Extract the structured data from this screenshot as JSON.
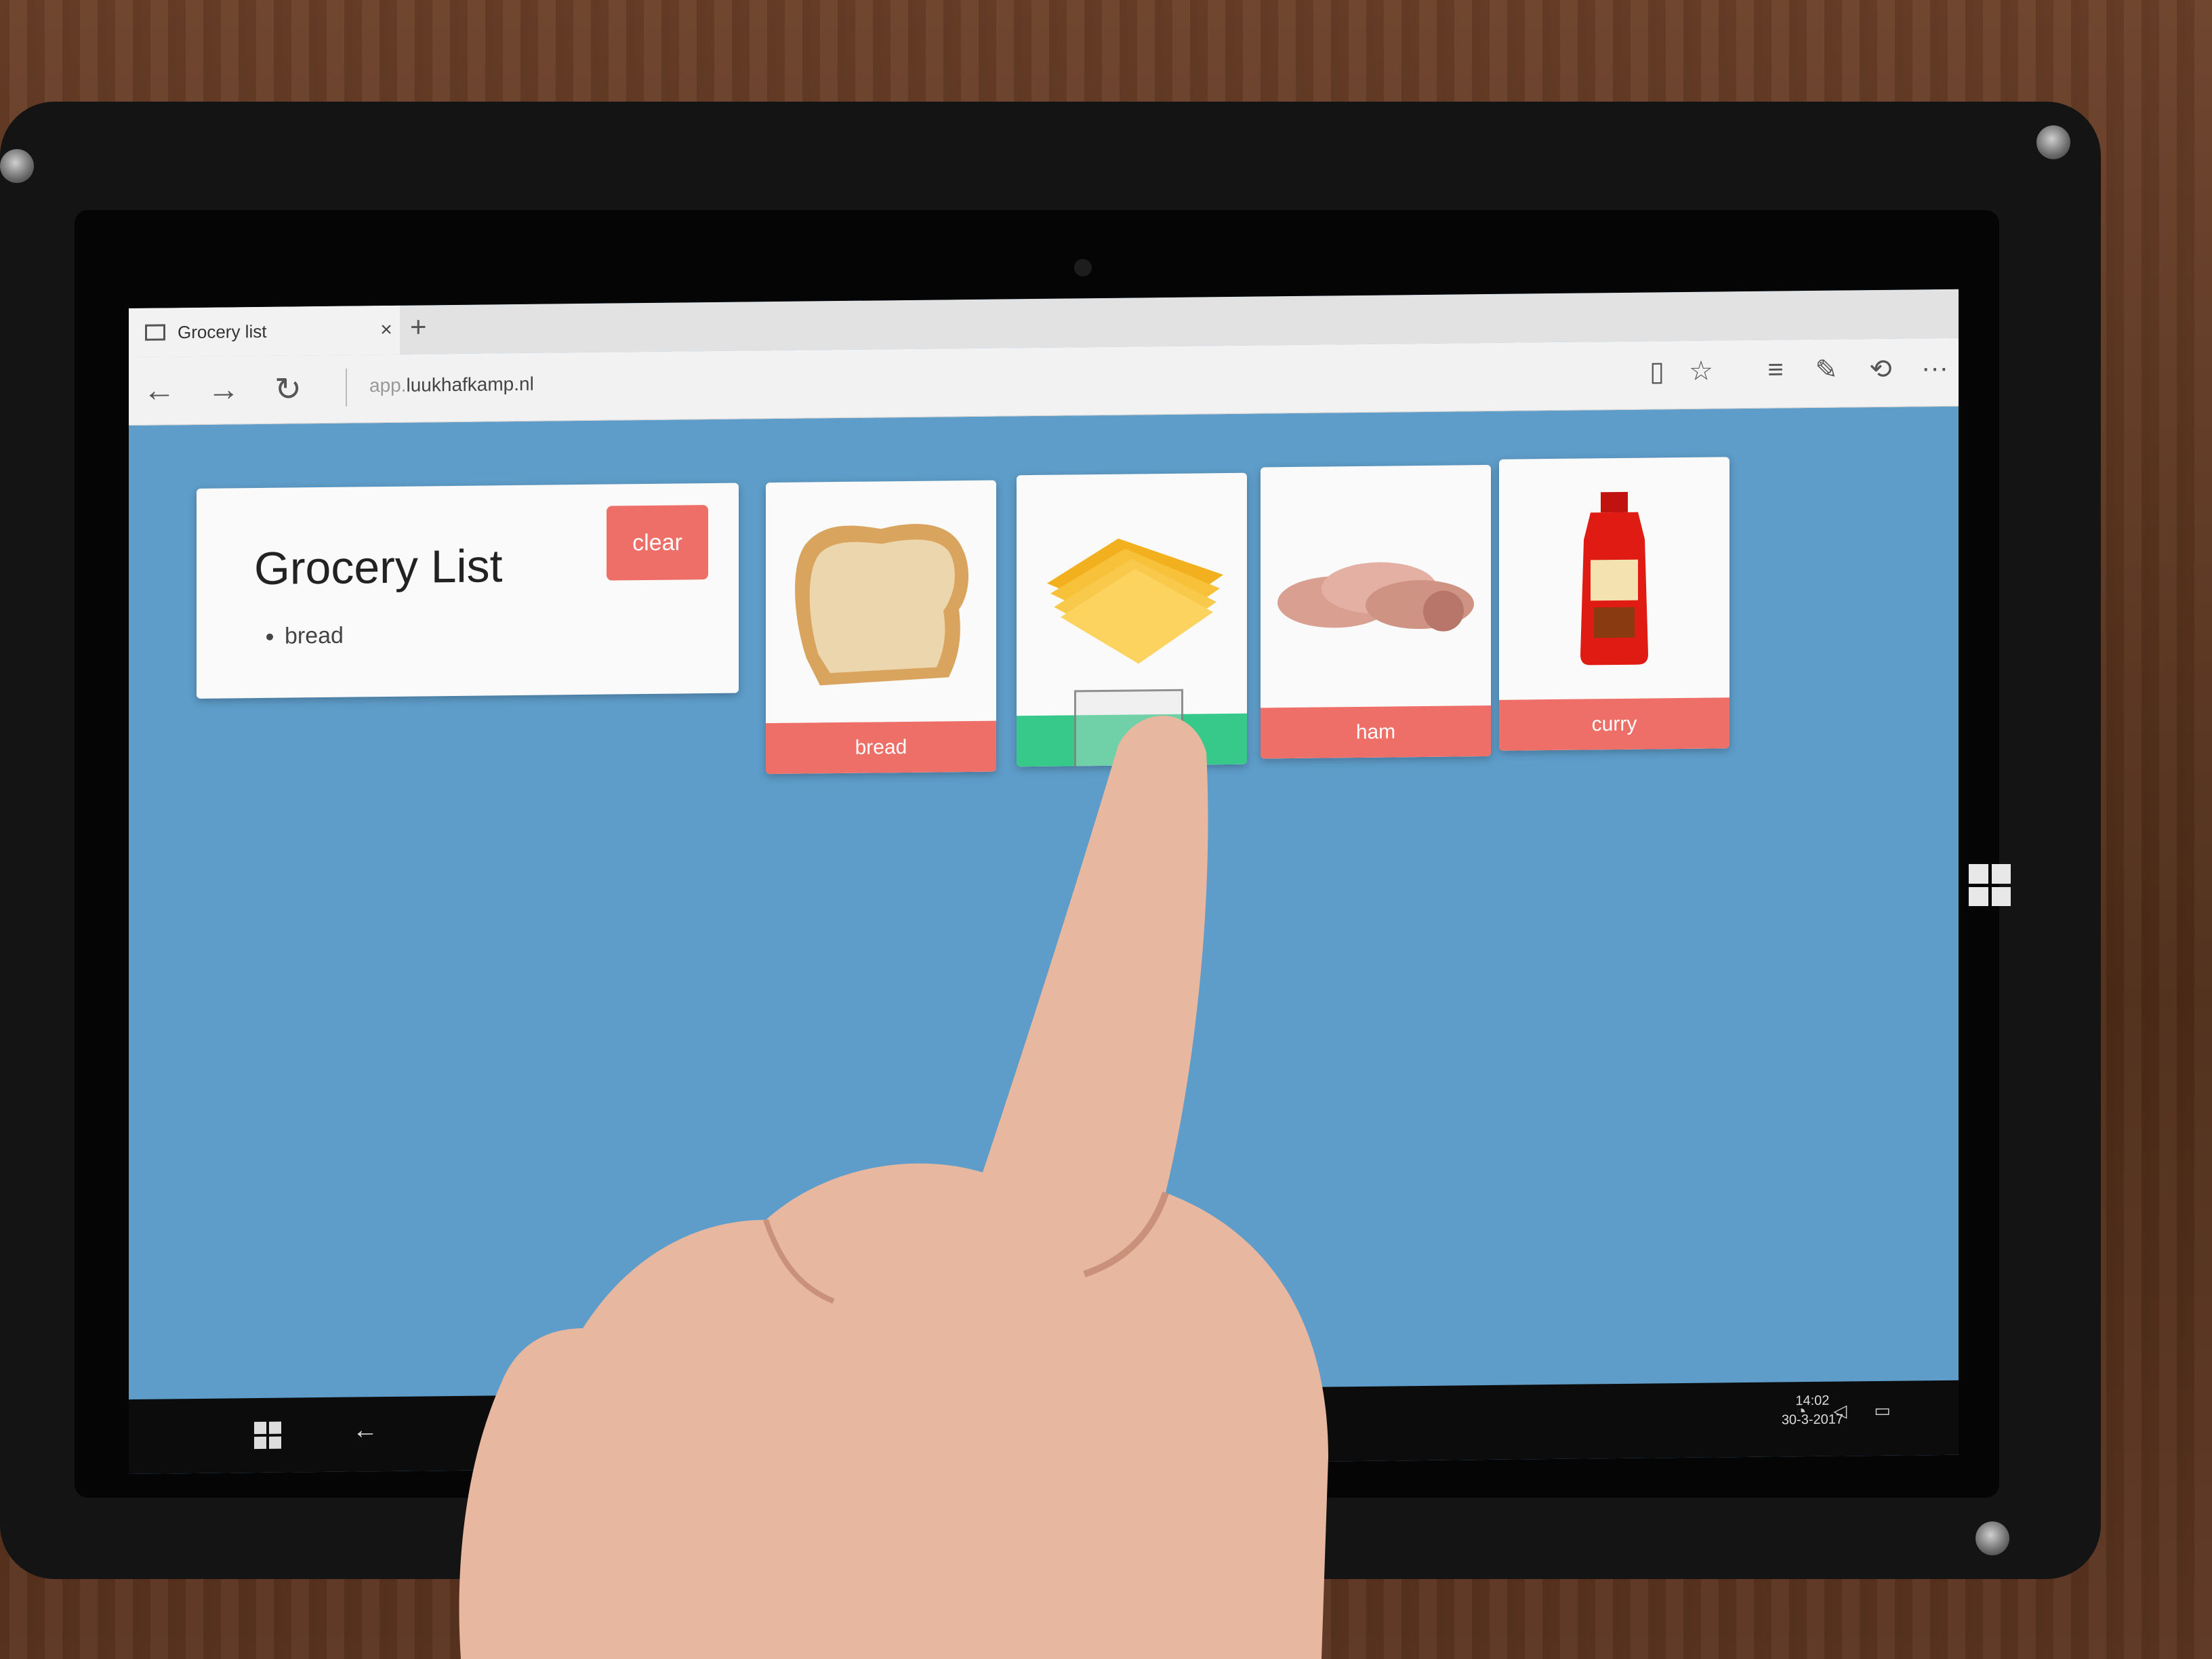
{
  "browser": {
    "tab_title": "Grocery list",
    "tab_close": "×",
    "new_tab": "+",
    "url_prefix": "app.",
    "url_domain": "luukhafkamp.nl",
    "nav": {
      "back": "←",
      "forward": "→",
      "refresh": "↻"
    },
    "tools": {
      "reading_view": "▯",
      "favorite": "☆",
      "hub": "≡",
      "web_note": "✎",
      "share": "⟲",
      "more": "···"
    }
  },
  "list_card": {
    "title": "Grocery List",
    "clear_label": "clear",
    "items": [
      "bread"
    ]
  },
  "items": [
    {
      "label": "bread",
      "icon": "bread-slice-image",
      "state": "default"
    },
    {
      "label": "",
      "icon": "cheese-slices-image",
      "state": "selected"
    },
    {
      "label": "ham",
      "icon": "ham-slices-image",
      "state": "default"
    },
    {
      "label": "curry",
      "icon": "curry-bottle-image",
      "state": "default"
    }
  ],
  "taskbar": {
    "back": "←",
    "clock_time": "14:02",
    "clock_date": "30-3-2017"
  },
  "colors": {
    "page_background": "#5e9dca",
    "label_default": "#ee6f68",
    "label_selected": "#36c98a",
    "clear_button": "#ee6f68"
  }
}
